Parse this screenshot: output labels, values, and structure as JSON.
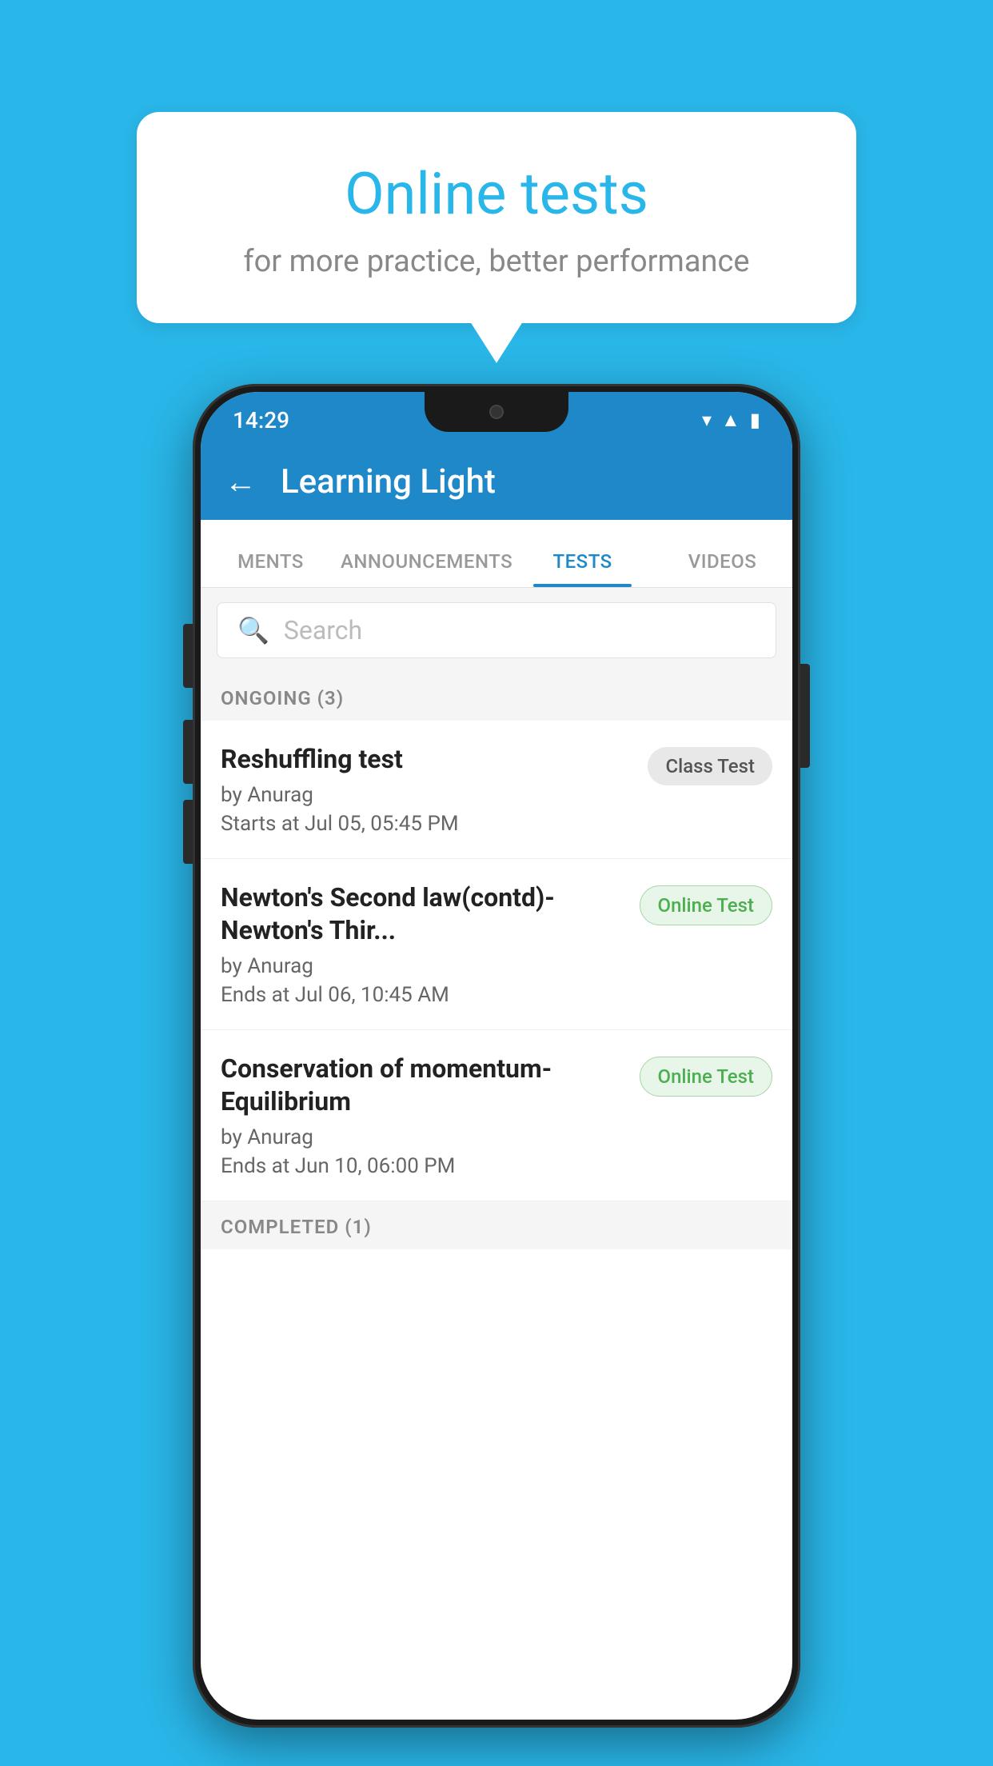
{
  "background_color": "#29b6e8",
  "bubble": {
    "title": "Online tests",
    "subtitle": "for more practice, better performance"
  },
  "phone": {
    "status_bar": {
      "time": "14:29",
      "icons": [
        "wifi",
        "signal",
        "battery"
      ]
    },
    "header": {
      "title": "Learning Light",
      "back_label": "←"
    },
    "tabs": [
      {
        "label": "MENTS",
        "active": false
      },
      {
        "label": "ANNOUNCEMENTS",
        "active": false
      },
      {
        "label": "TESTS",
        "active": true
      },
      {
        "label": "VIDEOS",
        "active": false
      }
    ],
    "search": {
      "placeholder": "Search"
    },
    "ongoing_section": {
      "title": "ONGOING (3)"
    },
    "test_items": [
      {
        "name": "Reshuffling test",
        "author": "by Anurag",
        "time_label": "Starts at",
        "time": "Jul 05, 05:45 PM",
        "badge": "Class Test",
        "badge_type": "class"
      },
      {
        "name": "Newton's Second law(contd)-Newton's Thir...",
        "author": "by Anurag",
        "time_label": "Ends at",
        "time": "Jul 06, 10:45 AM",
        "badge": "Online Test",
        "badge_type": "online"
      },
      {
        "name": "Conservation of momentum-Equilibrium",
        "author": "by Anurag",
        "time_label": "Ends at",
        "time": "Jun 10, 06:00 PM",
        "badge": "Online Test",
        "badge_type": "online"
      }
    ],
    "completed_section": {
      "title": "COMPLETED (1)"
    }
  }
}
